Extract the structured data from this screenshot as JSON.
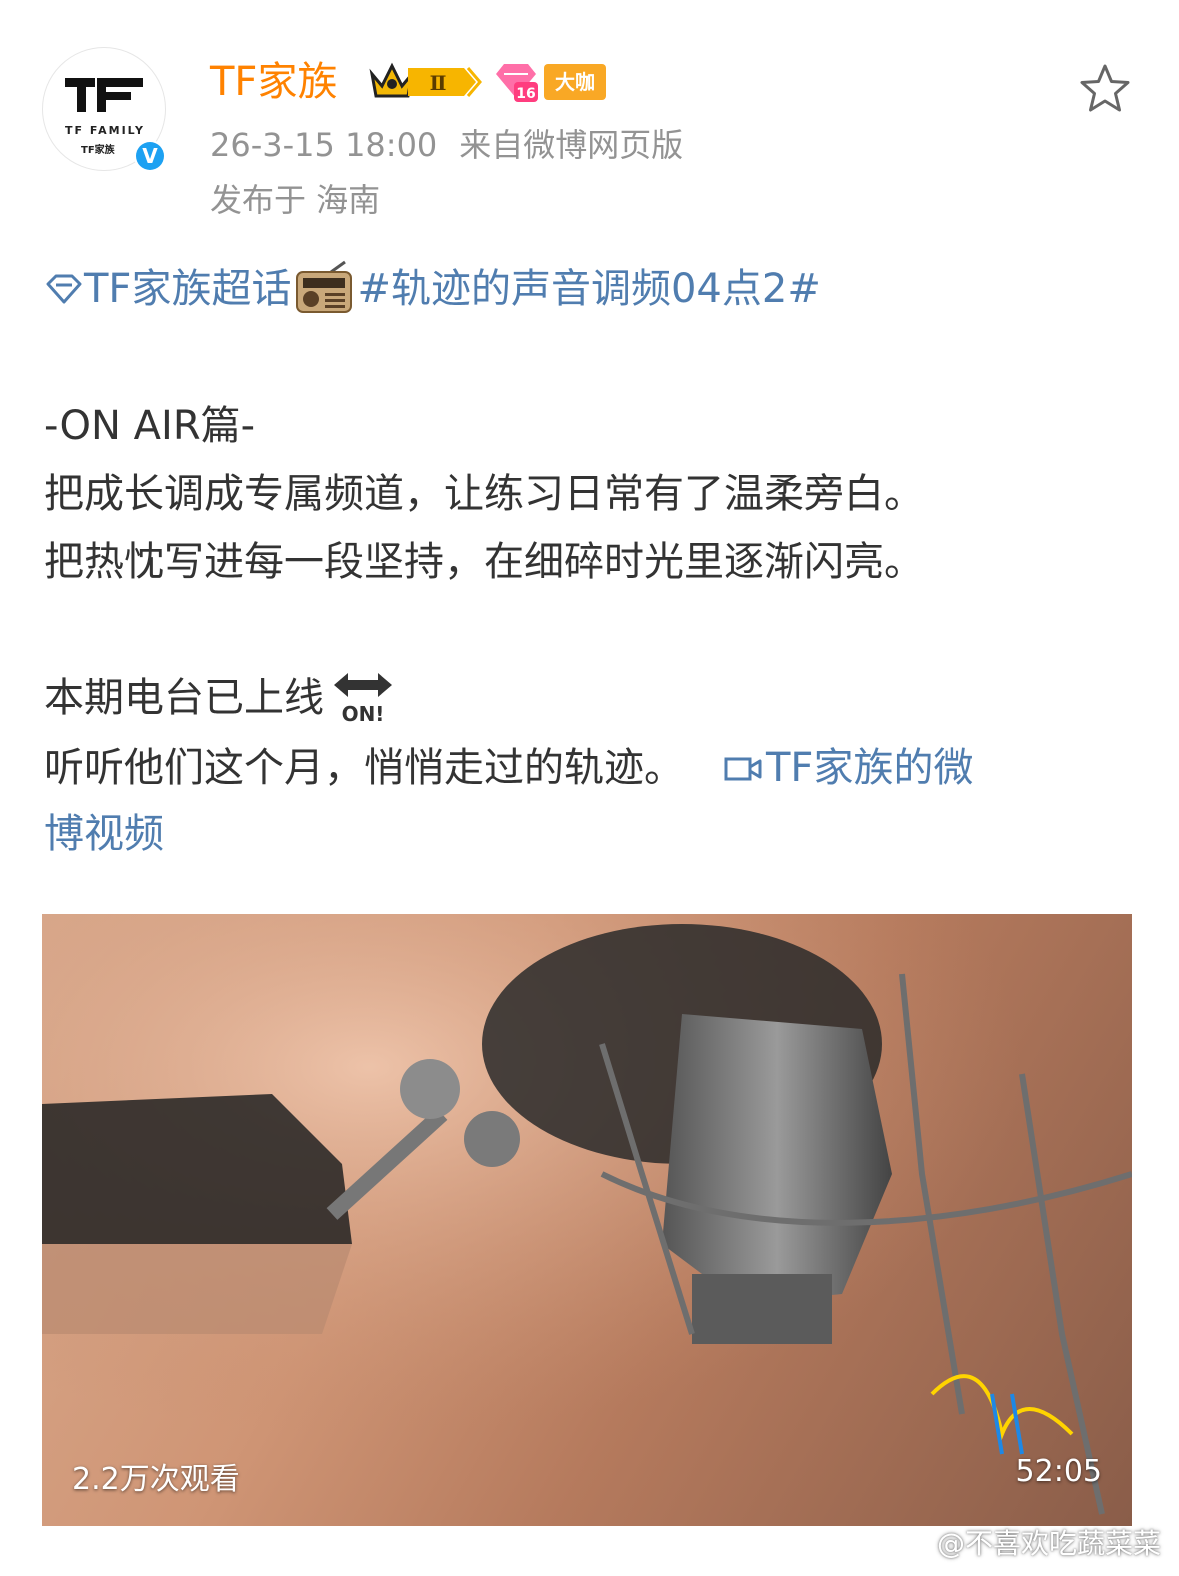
{
  "post": {
    "username": "TF家族",
    "rank_badge": "Ⅱ",
    "level_badge": "16",
    "daka_badge": "大咖",
    "timestamp": "26-3-15 18:00",
    "source": "来自微博网页版",
    "location": "发布于 海南",
    "avatar_brand": "TF FAMILY",
    "avatar_sub": "TF家族"
  },
  "content": {
    "topic_super": "TF家族超话",
    "topic_tag": "#轨迹的声音调频04点2#",
    "line1": "-ON AIR篇-",
    "line2": "把成长调成专属频道，让练习日常有了温柔旁白。",
    "line3": "把热忱写进每一段坚持，在细碎时光里逐渐闪亮。",
    "line4": "本期电台已上线",
    "line5": "听听他们这个月，悄悄走过的轨迹。",
    "video_link_part1": "TF家族的微",
    "video_link_part2": "博视频",
    "on_emoji_text": "ON!"
  },
  "video": {
    "views": "2.2万次观看",
    "duration": "52:05"
  },
  "watermark": "@不喜欢吃蔬菜菜",
  "colors": {
    "username": "#ff8200",
    "link": "#507daf",
    "meta": "#939393",
    "text": "#333333"
  },
  "icons": [
    "star-icon",
    "verified-icon",
    "crown-badge-icon",
    "diamond-badge-icon",
    "super-topic-icon",
    "radio-emoji-icon",
    "on-arrow-emoji-icon",
    "video-link-icon"
  ]
}
